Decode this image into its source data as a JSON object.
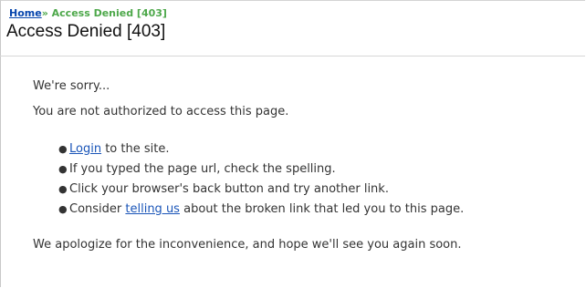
{
  "breadcrumb": {
    "home_label": "Home",
    "separator": "»",
    "current": "Access Denied [403]"
  },
  "page": {
    "title": "Access Denied [403]"
  },
  "content": {
    "sorry": "We're sorry...",
    "not_authorized": "You are not authorized to access this page.",
    "suggestions": {
      "login_link": "Login",
      "login_rest": " to the site.",
      "typed_url": "If you typed the page url, check the spelling.",
      "back_button": "Click your browser's back button and try another link.",
      "consider_prefix": "Consider ",
      "telling_us_link": "telling us",
      "consider_suffix": " about the broken link that led you to this page."
    },
    "apology": "We apologize for the inconvenience, and hope we'll see you again soon."
  },
  "colors": {
    "link": "#1a55b8",
    "breadcrumb_current": "#4da84a",
    "text": "#333333"
  }
}
